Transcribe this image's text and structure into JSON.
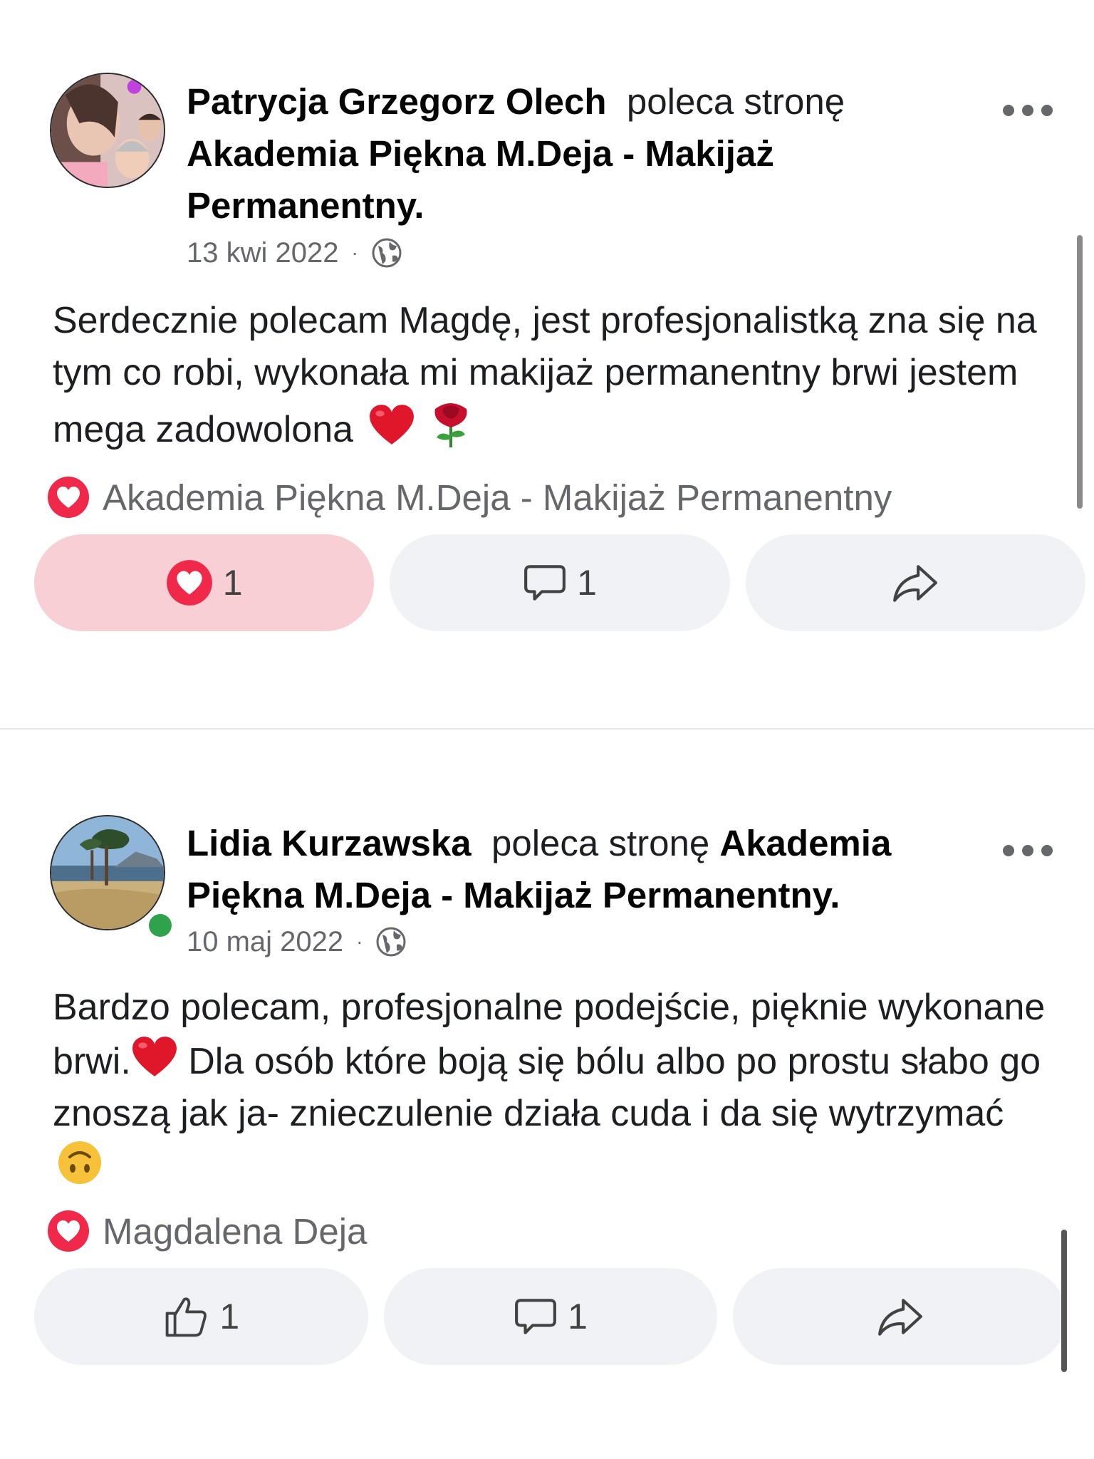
{
  "posts": [
    {
      "author": "Patrycja Grzegorz Olech",
      "verb": "poleca stronę",
      "page_name": "Akademia Piękna M.Deja  - Makijaż Permanentny.",
      "date": "13 kwi 2022",
      "separator": "·",
      "text": "Serdecznie polecam Magdę, jest profesjonalistką zna się na tym co robi, wykonała mi makijaż permanentny brwi jestem mega zadowolona",
      "emojis": [
        "red-heart",
        "rose"
      ],
      "reacted_by": "Akademia Piękna M.Deja  - Makijaż Permanentny",
      "reaction_count": "1",
      "comment_count": "1",
      "liked": true
    },
    {
      "author": "Lidia Kurzawska",
      "verb": "poleca stronę",
      "page_name": "Akademia Piękna M.Deja  - Makijaż Permanentny.",
      "date": "10 maj 2022",
      "separator": "·",
      "text_part_1": "Bardzo polecam, profesjonalne podejście, pięknie wykonane brwi.",
      "text_part_2": " Dla osób które boją się bólu albo po prostu słabo go znoszą jak ja- znieczulenie działa cuda i da się wytrzymać",
      "emojis": [
        "red-heart",
        "upside-down-face"
      ],
      "reacted_by": "Magdalena Deja",
      "reaction_count": "1",
      "comment_count": "1",
      "liked": false,
      "online": true
    }
  ],
  "colors": {
    "heart": "#f0284a",
    "liked_button_bg": "#f8cfd5",
    "button_bg": "#f0f2f5",
    "secondary_text": "#65676b",
    "online": "#31a24c"
  }
}
